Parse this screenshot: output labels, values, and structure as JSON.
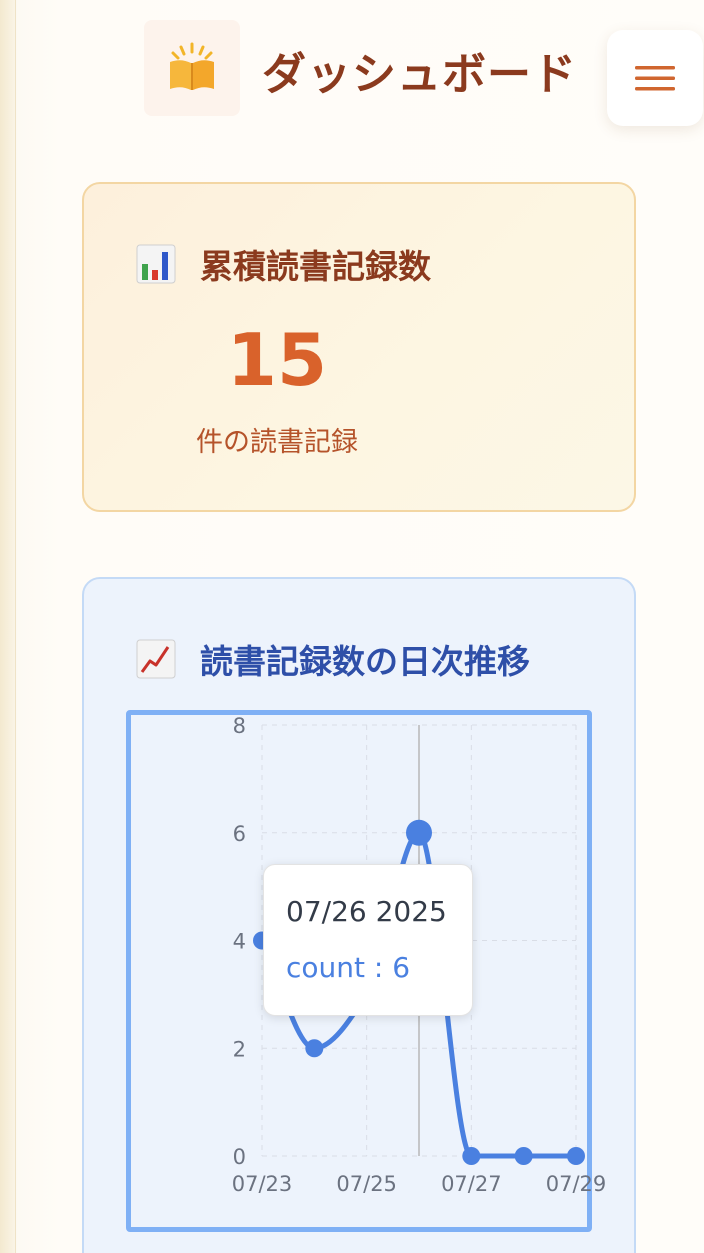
{
  "header": {
    "title": "ダッシュボード",
    "logo_icon": "open-book-icon",
    "menu_icon": "hamburger-menu-icon"
  },
  "total_card": {
    "icon": "bar-chart-icon",
    "title": "累積読書記録数",
    "count": "15",
    "unit": "件の読書記録"
  },
  "trend_card": {
    "icon": "line-chart-icon",
    "title": "読書記録数の日次推移"
  },
  "tooltip": {
    "date": "07/26 2025",
    "count_text": "count : 6"
  },
  "colors": {
    "line": "#4a80e0",
    "title_brown": "#8b3a1e",
    "count_orange": "#d9622b",
    "title_blue": "#2e4fa8"
  },
  "chart_data": {
    "type": "line",
    "x": [
      "07/23",
      "07/24",
      "07/25",
      "07/26",
      "07/27",
      "07/28",
      "07/29"
    ],
    "x_tick_labels": [
      "07/23",
      "07/25",
      "07/27",
      "07/29"
    ],
    "series": [
      {
        "name": "count",
        "values": [
          4,
          2,
          3,
          6,
          0,
          0,
          0
        ]
      }
    ],
    "y_ticks": [
      "0",
      "2",
      "4",
      "6",
      "8"
    ],
    "ylim": [
      0,
      8
    ],
    "grid": true,
    "highlighted_index": 3
  }
}
